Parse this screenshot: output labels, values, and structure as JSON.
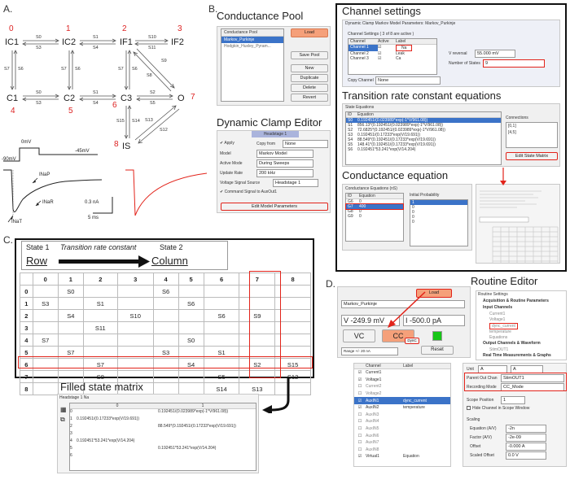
{
  "panel_labels": {
    "a": "A.",
    "b": "B.",
    "c": "C.",
    "d": "D."
  },
  "state_diagram": {
    "states": [
      {
        "name": "IC1",
        "num": "0"
      },
      {
        "name": "IC2",
        "num": "1"
      },
      {
        "name": "IF1",
        "num": "2"
      },
      {
        "name": "IF2",
        "num": "3"
      },
      {
        "name": "C1",
        "num": "4"
      },
      {
        "name": "C2",
        "num": "5"
      },
      {
        "name": "C3",
        "num": "6"
      },
      {
        "name": "O",
        "num": "7"
      },
      {
        "name": "IS",
        "num": "8"
      }
    ],
    "rates": [
      "S0",
      "S3",
      "S1",
      "S4",
      "S10",
      "S11",
      "S7",
      "S6",
      "S7",
      "S6",
      "S7",
      "S6",
      "S9",
      "S8",
      "S0",
      "S3",
      "S1",
      "S4",
      "S2",
      "S5",
      "S15",
      "S14",
      "S13",
      "S12"
    ]
  },
  "protocol": {
    "v_hold": "-90mV",
    "v_step": "0mV",
    "v_tail": "-45mV"
  },
  "traces": {
    "labels": [
      "INaP",
      "INaR",
      "INaT"
    ],
    "scale_current": "0.3 nA",
    "scale_time": "5 ms"
  },
  "conductance_pool": {
    "title": "Conductance Pool",
    "list_header": "Conductance Pool",
    "items": [
      "Markov_Purkinje",
      "Hodgkin_Huxley_Pyram..."
    ],
    "buttons": [
      "Load",
      "Save Pool",
      "New",
      "Duplicate",
      "Delete",
      "Revert"
    ]
  },
  "dce": {
    "title": "Dynamic Clamp Editor",
    "tab": "Headstage 1",
    "apply": "Apply",
    "copy_from_label": "Copy from",
    "copy_from_value": "None",
    "rows": [
      {
        "label": "Model",
        "value": "Markov Model"
      },
      {
        "label": "Active Mode",
        "value": "During Sweeps"
      },
      {
        "label": "Update Rate",
        "value": "200 kHz"
      },
      {
        "label": "Voltage Signal Source",
        "value": "Headstage 1"
      }
    ],
    "command_signal": "Command Signal to AuxOut1",
    "edit_button": "Edit Model Parameters"
  },
  "channel_settings": {
    "title": "Channel settings",
    "window_title": "Dynamic Clamp Markov Model Parameters: Markov_Purkinje",
    "group_label": "Channel Settings ( 3 of 8 are active )",
    "columns": [
      "Channel",
      "Active",
      "Label"
    ],
    "rows": [
      {
        "channel": "Channel 1",
        "label": "Na"
      },
      {
        "channel": "Channel 2",
        "label": "Leak"
      },
      {
        "channel": "Channel 3",
        "label": "Ca"
      }
    ],
    "v_reversal_label": "V reversal",
    "v_reversal_value": "55.000 mV",
    "num_states_label": "Number of States",
    "num_states_value": "9",
    "copy_channel_label": "Copy Channel",
    "copy_channel_value": "None"
  },
  "transition": {
    "title": "Transition rate constant equations",
    "group_label": "State Equations",
    "columns": [
      "ID",
      "Equation"
    ],
    "rows": [
      {
        "id": "S0",
        "eq": "0.192451/(0.023989*exp(-1*V/961.08))"
      },
      {
        "id": "S1",
        "eq": "856.13*(0.192451/(0.023989*exp(-1*V/961.08))"
      },
      {
        "id": "S2",
        "eq": "72.6825*(0.192451/(0.023989*exp(-1*V/961.08))"
      },
      {
        "id": "S3",
        "eq": "0.192451/(0.17233*exp(V/19.691))"
      },
      {
        "id": "S4",
        "eq": "88.549*(0.192451/(0.17233*exp(V/19.691))"
      },
      {
        "id": "S5",
        "eq": "148.41*(0.192451/(0.17233*exp(V/19.691))"
      },
      {
        "id": "S6",
        "eq": "0.192451*53.241*exp(V/14.204)"
      }
    ],
    "connections_label": "Connections",
    "connections": [
      "[0,1]",
      "[4,5]"
    ],
    "edit_matrix": "Edit State Matrix"
  },
  "conductance_eq": {
    "title": "Conductance equation",
    "group_label": "Conductance Equations (nS)",
    "columns": [
      "ID",
      "Equation"
    ],
    "rows": [
      {
        "id": "G6",
        "eq": "0"
      },
      {
        "id": "G7",
        "eq": "400"
      },
      {
        "id": "G8",
        "eq": "0"
      },
      {
        "id": "G9",
        "eq": "0"
      }
    ],
    "initial_label": "Initial Probability",
    "initial_values": [
      "1",
      "0",
      "0",
      "0",
      "0"
    ]
  },
  "matrix_panel": {
    "state1": "State 1",
    "rate_label": "Transition rate constant",
    "state2": "State 2",
    "row_label": "Row",
    "col_label": "Column",
    "headers": [
      "",
      "0",
      "1",
      "2",
      "3",
      "4",
      "5",
      "6",
      "7",
      "8"
    ],
    "rows": [
      [
        "0",
        "",
        "S0",
        "",
        "",
        "S6",
        "",
        "",
        "",
        ""
      ],
      [
        "1",
        "S3",
        "",
        "S1",
        "",
        "",
        "S6",
        "",
        "",
        ""
      ],
      [
        "2",
        "",
        "S4",
        "",
        "S10",
        "",
        "",
        "S6",
        "S9",
        ""
      ],
      [
        "3",
        "",
        "",
        "S11",
        "",
        "",
        "",
        "",
        "",
        ""
      ],
      [
        "4",
        "S7",
        "",
        "",
        "",
        "",
        "S0",
        "",
        "",
        ""
      ],
      [
        "5",
        "",
        "S7",
        "",
        "",
        "S3",
        "",
        "S1",
        "",
        ""
      ],
      [
        "6",
        "",
        "",
        "S7",
        "",
        "",
        "S4",
        "",
        "S2",
        "S15"
      ],
      [
        "7",
        "",
        "",
        "S8",
        "",
        "",
        "",
        "S5",
        "",
        "S12"
      ],
      [
        "8",
        "",
        "",
        "",
        "",
        "",
        "",
        "S14",
        "S13",
        ""
      ]
    ]
  },
  "filled_matrix": {
    "title": "Filled state matrix",
    "tab": "Headstage 1 Na",
    "headers": [
      "0",
      "1"
    ],
    "rows": [
      {
        "idx": "0",
        "c0": "",
        "c1": "0.192451/(0.023989*exp(-1*V/961.08))"
      },
      {
        "idx": "1",
        "c0": "0.192451/(0.17233*exp(V/19.691))",
        "c1": ""
      },
      {
        "idx": "2",
        "c0": "",
        "c1": "88.549*(0.192451/(0.17233*exp(V/19.691))"
      },
      {
        "idx": "3",
        "c0": "",
        "c1": ""
      },
      {
        "idx": "4",
        "c0": "0.192451*53.241*exp(V/14.204)",
        "c1": ""
      },
      {
        "idx": "5",
        "c0": "",
        "c1": "0.192451*53.241*exp(V/14.204)"
      },
      {
        "idx": "6",
        "c0": "",
        "c1": ""
      }
    ]
  },
  "routine_editor": {
    "title": "Routine Editor",
    "load": "Load",
    "protocol": "Markov_Purkinje",
    "v_display": "V  -249.9 mV",
    "i_display": "I  -500.0 pA",
    "vc": "VC",
    "cc": "CC",
    "dync": "DynC",
    "reset": "Reset",
    "range": "Range +/- 20 nA",
    "tree_root": "Routine Settings",
    "tree": [
      "Acquisition & Routine Parameters",
      "Input Channels",
      "Current1",
      "Voltage1",
      "dync_current",
      "temperature",
      "Equations",
      "Output Channels & Waveform",
      "StimOUT1",
      "Real Time Measurements & Graphs"
    ],
    "channel_header": [
      "Channel",
      "Label"
    ],
    "channels": [
      {
        "name": "Current1",
        "label": "",
        "checked": true
      },
      {
        "name": "Voltage1",
        "label": "",
        "checked": true
      },
      {
        "name": "Current2",
        "label": "",
        "checked": false
      },
      {
        "name": "Voltage2",
        "label": "",
        "checked": false
      },
      {
        "name": "AuxIN1",
        "label": "dync_current",
        "checked": true
      },
      {
        "name": "AuxIN2",
        "label": "temperature",
        "checked": true
      },
      {
        "name": "AuxIN3",
        "label": "",
        "checked": false
      },
      {
        "name": "AuxIN4",
        "label": "",
        "checked": false
      },
      {
        "name": "AuxIN5",
        "label": "",
        "checked": false
      },
      {
        "name": "AuxIN6",
        "label": "",
        "checked": false
      },
      {
        "name": "AuxIN7",
        "label": "",
        "checked": false
      },
      {
        "name": "AuxIN8",
        "label": "",
        "checked": false
      },
      {
        "name": "Virtual1",
        "label": "Equation",
        "checked": true
      }
    ],
    "unit_label": "Unit",
    "unit_value": "A",
    "unit_value2": "A",
    "parent_label": "Parent Out Chan",
    "parent_value": "StimOUT1",
    "recording_label": "Recording Mode",
    "recording_value": "CC_Mode",
    "scope_label": "Scope Position",
    "scope_value": "1",
    "hide_label": "Hide Channel in Scope Window",
    "scaling_label": "Scaling",
    "eq_label": "Equation (A/V)",
    "eq_value": "-2n",
    "factor_label": "Factor (A/V)",
    "factor_value": "-2e-09",
    "offset_label": "Offset",
    "offset_value": "-0.000 A",
    "scaled_label": "Scaled Offset",
    "scaled_value": "0.0 V"
  },
  "colors": {
    "red": "#e2231a",
    "load_orange": "#f5a07a",
    "select_blue": "#3b73c8",
    "green": "#16c616"
  }
}
